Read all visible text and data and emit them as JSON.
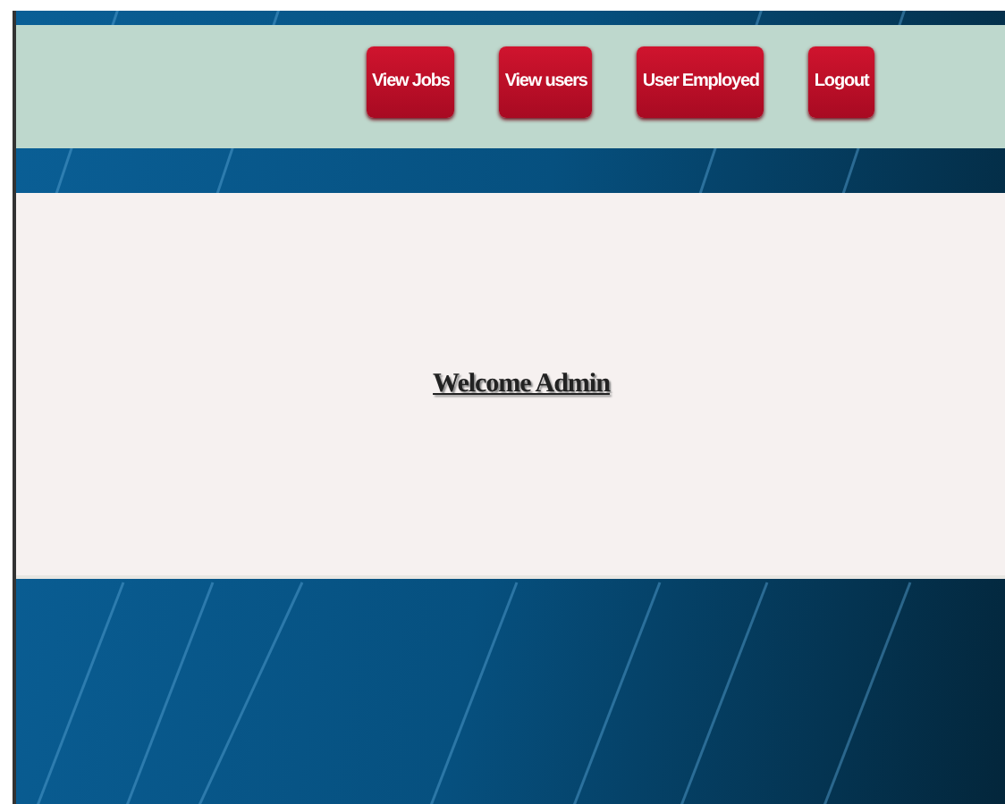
{
  "nav": {
    "buttons": [
      "View Jobs",
      "View users",
      "User Employed",
      "Logout"
    ]
  },
  "main": {
    "heading": "Welcome Admin"
  }
}
